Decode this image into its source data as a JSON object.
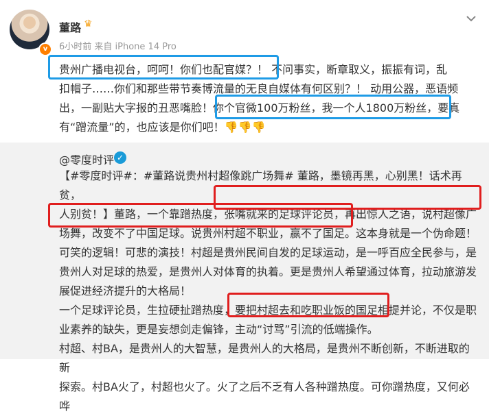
{
  "user": {
    "name": "董路",
    "time_source": "6小时前 来自 iPhone 14 Pro",
    "badge": "v"
  },
  "post": {
    "lines": [
      "贵州广播电视台，呵呵！你们也配官媒？！ 不问事实，断章取义，振振有词，乱",
      "扣帽子……你们和那些带节奏博流量的无良自媒体有何区别？！ 动用公器，恶语频",
      "出，一副贴大字报的丑恶嘴脸！你个官微100万粉丝，我一个人1800万粉丝，要真",
      "有“蹭流量”的，也应该是你们吧！"
    ],
    "thumbs": "👎👎👎"
  },
  "repost": {
    "author": "@零度时评",
    "lines": [
      "【#零度时评#：#董路说贵州村超像跳广场舞# 董路，墨镜再黑，心别黑！话术再贫，",
      "人别贫！】董路，一个靠蹭热度，张嘴就来的足球评论员，再出惊人之语，说村超像广",
      "场舞，改变不了中国足球。说贵州村超不职业，赢不了国足。这本身就是一个伪命题！",
      "可笑的逻辑！可悲的演技！村超是贵州民间自发的足球运动，是一呼百应全民参与，是",
      "贵州人对足球的热爱，是贵州人对体育的执着。更是贵州人希望通过体育，拉动旅游发",
      "展促进经济提升的大格局！",
      "一个足球评论员，生拉硬扯蹭热度，要把村超去和吃职业饭的国足相提并论，不仅是职",
      "业素养的缺失，更是妄想剑走偏锋，主动“讨骂”引流的低端操作。",
      "村超、村BA，是贵州人的大智慧，是贵州人的大格局，是贵州不断创新，不断进取的新",
      "探索。村BA火了，村超也火了。火了之后不乏有人各种蹭热度。可你蹭热度，又何必哗"
    ]
  }
}
